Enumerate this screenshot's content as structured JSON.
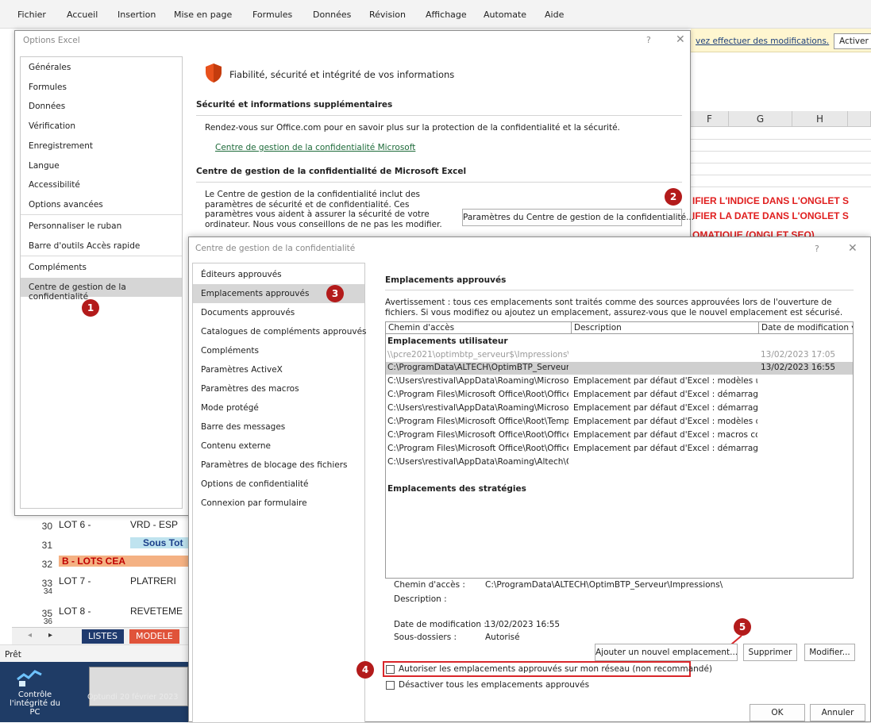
{
  "ribbon": {
    "tabs": [
      "Fichier",
      "Accueil",
      "Insertion",
      "Mise en page",
      "Formules",
      "Données",
      "Révision",
      "Affichage",
      "Automate",
      "Aide"
    ]
  },
  "message_bar": {
    "link": "vez effectuer des modifications.",
    "button": "Activer"
  },
  "sheet": {
    "col_f": "F",
    "col_g": "G",
    "col_h": "H",
    "red_lines": [
      "IFIER L'INDICE DANS L'ONGLET S",
      "IFIER LA DATE  DANS L'ONGLET S",
      "OMATIQUE (ONGLET SEQ)"
    ],
    "rows": [
      {
        "num": "30",
        "a": "LOT 6 -",
        "b": "VRD - ESP"
      },
      {
        "num": "31",
        "a": "",
        "b": "Sous Tot"
      },
      {
        "num": "32",
        "a": "B - LOTS CEA",
        "b": ""
      },
      {
        "num": "33",
        "a": "LOT 7 -",
        "b": "PLATRERI"
      },
      {
        "num": "34",
        "a": "",
        "b": ""
      },
      {
        "num": "35",
        "a": "LOT 8 -",
        "b": "REVETEME"
      },
      {
        "num": "36",
        "a": "",
        "b": ""
      }
    ],
    "tabs": [
      "LISTES",
      "MODELE"
    ],
    "status": "Prêt"
  },
  "taskbar": {
    "icon_label": "Contrôle l'intégrité du PC",
    "thumb_text": "Optundi 20 février 2023"
  },
  "options_dialog": {
    "title": "Options Excel",
    "help": "?",
    "close": "✕",
    "nav": [
      "Générales",
      "Formules",
      "Données",
      "Vérification",
      "Enregistrement",
      "Langue",
      "Accessibilité",
      "Options avancées",
      "Personnaliser le ruban",
      "Barre d'outils Accès rapide",
      "Compléments",
      "Centre de gestion de la confidentialité"
    ],
    "heading": "Fiabilité, sécurité et intégrité de vos informations",
    "sec1_title": "Sécurité et informations supplémentaires",
    "sec1_text": "Rendez-vous sur Office.com pour en savoir plus sur la protection de la confidentialité et la sécurité.",
    "sec1_link": "Centre de gestion de la confidentialité Microsoft",
    "sec2_title": "Centre de gestion de la confidentialité de Microsoft Excel",
    "sec2_text": "Le Centre de gestion de la confidentialité inclut des paramètres de sécurité et de confidentialité. Ces paramètres vous aident à assurer la sécurité de votre ordinateur. Nous vous conseillons de ne pas les modifier.",
    "sec2_button": "Paramètres du Centre de gestion de la confidentialité..."
  },
  "trust_dialog": {
    "title": "Centre de gestion de la confidentialité",
    "help": "?",
    "close": "✕",
    "nav": [
      "Éditeurs approuvés",
      "Emplacements approuvés",
      "Documents approuvés",
      "Catalogues de compléments approuvés",
      "Compléments",
      "Paramètres ActiveX",
      "Paramètres des macros",
      "Mode protégé",
      "Barre des messages",
      "Contenu externe",
      "Paramètres de blocage des fichiers",
      "Options de confidentialité",
      "Connexion par formulaire"
    ],
    "heading": "Emplacements approuvés",
    "warning": "Avertissement : tous ces emplacements sont traités comme des sources approuvées lors de l'ouverture de fichiers. Si vous modifiez ou ajoutez un emplacement, assurez-vous que le nouvel emplacement est sécurisé.",
    "columns": [
      "Chemin d'accès",
      "Description",
      "Date de modification ▾"
    ],
    "group_user": "Emplacements utilisateur",
    "rows": [
      {
        "path": "\\\\pcre2021\\optimbtp_serveur$\\Impressions\\",
        "desc": "",
        "date": "13/02/2023 17:05"
      },
      {
        "path": "C:\\ProgramData\\ALTECH\\OptimBTP_Serveur\\I",
        "desc": "",
        "date": "13/02/2023 16:55"
      },
      {
        "path": "C:\\Users\\restival\\AppData\\Roaming\\Microsoft",
        "desc": "Emplacement par défaut d'Excel : modèles u...",
        "date": ""
      },
      {
        "path": "C:\\Program Files\\Microsoft Office\\Root\\Office",
        "desc": "Emplacement par défaut d'Excel : démarrage...",
        "date": ""
      },
      {
        "path": "C:\\Users\\restival\\AppData\\Roaming\\Microsoft",
        "desc": "Emplacement par défaut d'Excel : démarrage...",
        "date": ""
      },
      {
        "path": "C:\\Program Files\\Microsoft Office\\Root\\Templ",
        "desc": "Emplacement par défaut d'Excel : modèles d'...",
        "date": ""
      },
      {
        "path": "C:\\Program Files\\Microsoft Office\\Root\\Office",
        "desc": "Emplacement par défaut d'Excel : macros co...",
        "date": ""
      },
      {
        "path": "C:\\Program Files\\Microsoft Office\\Root\\Office",
        "desc": "Emplacement par défaut d'Excel : démarrage...",
        "date": ""
      },
      {
        "path": "C:\\Users\\restival\\AppData\\Roaming\\Altech\\O",
        "desc": "",
        "date": ""
      }
    ],
    "group_policy": "Emplacements des stratégies",
    "detail_path_label": "Chemin d'accès :",
    "detail_path": "C:\\ProgramData\\ALTECH\\OptimBTP_Serveur\\Impressions\\",
    "detail_desc_label": "Description :",
    "detail_date_label": "Date de modification :",
    "detail_date": "13/02/2023 16:55",
    "detail_sub_label": "Sous-dossiers :",
    "detail_sub": "Autorisé",
    "btn_add": "Ajouter un nouvel emplacement...",
    "btn_delete": "Supprimer",
    "btn_modify": "Modifier...",
    "cb_network": "Autoriser les emplacements approuvés sur mon réseau (non recommandé)",
    "cb_disable": "Désactiver tous les emplacements approuvés",
    "btn_ok": "OK",
    "btn_cancel": "Annuler"
  },
  "badges": [
    "1",
    "2",
    "3",
    "4",
    "5"
  ],
  "colors": {
    "badge": "#b31b1b",
    "highlight_box": "#d9262a",
    "selected_row": "#cfcfcf",
    "link": "#1e6b3a"
  }
}
